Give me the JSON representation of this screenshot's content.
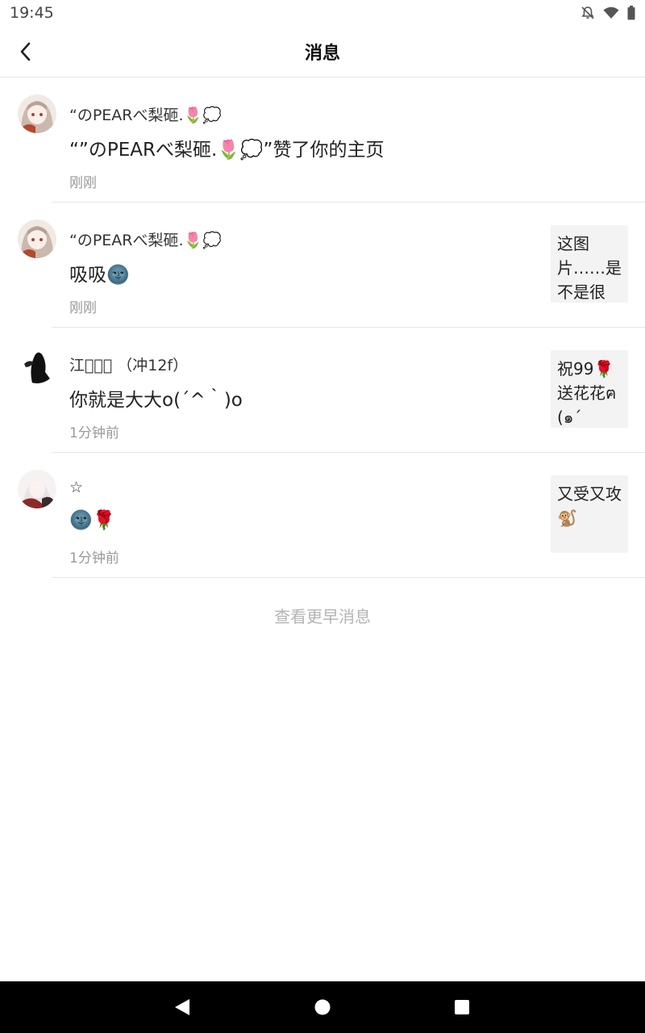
{
  "status_bar": {
    "time": "19:45"
  },
  "header": {
    "title": "消息"
  },
  "messages": [
    {
      "name": "“のPEARべ梨砸.🌷💭",
      "text": "“”のPEARべ梨砸.🌷💭”赞了你的主页",
      "time": "刚刚",
      "thumbnail": ""
    },
    {
      "name": "“のPEARべ梨砸.🌷💭",
      "text": "吸吸🌚",
      "time": "刚刚",
      "thumbnail": "这图片……是不是很"
    },
    {
      "name": "江楠⃣⃣ （冲12f）",
      "text": "你就是大大o(´^｀)o",
      "time": "1分钟前",
      "thumbnail": "祝99🌹送花花ฅ(๑´"
    },
    {
      "name": "☆",
      "text": "🌚🌹",
      "time": "1分钟前",
      "thumbnail": "又受又攻🐒"
    }
  ],
  "footer": {
    "older_label": "查看更早消息"
  }
}
